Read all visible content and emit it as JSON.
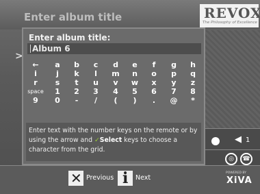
{
  "header": {
    "title": "Enter album title"
  },
  "brand": {
    "name": "REVOX",
    "tagline": "The Philosophy of Excellence"
  },
  "dialog": {
    "title": "Enter album title:",
    "input_value": "Album 6",
    "keys": [
      [
        "←",
        "a",
        "b",
        "c",
        "d",
        "e",
        "f",
        "g",
        "h"
      ],
      [
        "i",
        "j",
        "k",
        "l",
        "m",
        "n",
        "o",
        "p",
        "q"
      ],
      [
        "r",
        "s",
        "t",
        "u",
        "v",
        "w",
        "x",
        "y",
        "z"
      ],
      [
        "space",
        "1",
        "2",
        "3",
        "4",
        "5",
        "6",
        "7",
        "8"
      ],
      [
        "9",
        "0",
        "-",
        "/",
        "(",
        ")",
        ".",
        "@",
        "*"
      ]
    ],
    "help_part1": "Enter text with the number keys on the remote or by using the arrow and ",
    "help_check": "✓",
    "help_select": "Select",
    "help_part2": " keys to choose a character from the grid."
  },
  "status": {
    "volume_icon": "speaker-icon",
    "volume_level": "1"
  },
  "footer": {
    "previous_label": "Previous",
    "next_label": "Next",
    "powered_by": "POWERED BY",
    "platform": "XiVA"
  },
  "left_arrow": ">"
}
